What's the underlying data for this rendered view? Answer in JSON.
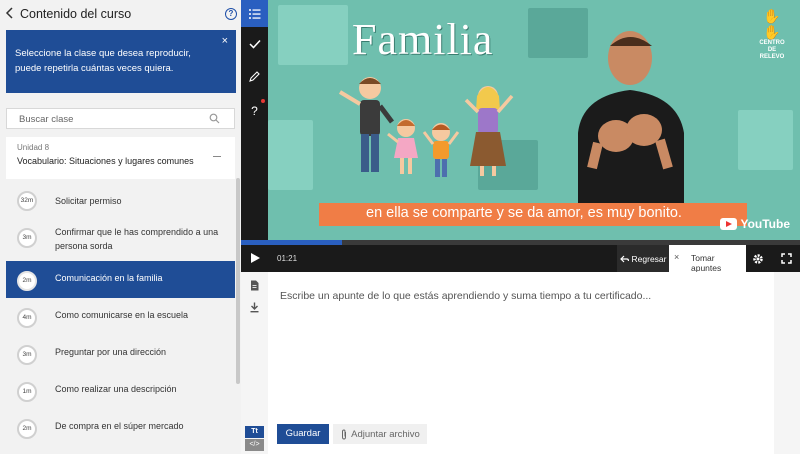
{
  "sidebar": {
    "back_icon": "chevron-left-icon",
    "title": "Contenido del curso",
    "help_icon": "question-circle-icon",
    "help_glyph": "?",
    "notice": {
      "text": "Seleccione la clase que desea reproducir, puede repetirla cuántas veces quiera.",
      "close_glyph": "×"
    },
    "search": {
      "placeholder": "Buscar clase"
    },
    "unit": {
      "label": "Unidad 8",
      "name": "Vocabulario: Situaciones y lugares comunes"
    },
    "lessons": [
      {
        "duration": "32m",
        "title": "Solicitar permiso",
        "active": false
      },
      {
        "duration": "3m",
        "title": "Confirmar que le has comprendido a una persona sorda",
        "active": false
      },
      {
        "duration": "2m",
        "title": "Comunicación en la familia",
        "active": true
      },
      {
        "duration": "4m",
        "title": "Como comunicarse en la escuela",
        "active": false
      },
      {
        "duration": "3m",
        "title": "Preguntar por una dirección",
        "active": false
      },
      {
        "duration": "1m",
        "title": "Como realizar una descripción",
        "active": false
      },
      {
        "duration": "2m",
        "title": "De compra en el súper mercado",
        "active": false
      }
    ]
  },
  "rail": {
    "items": [
      "list-icon",
      "check-icon",
      "pencil-icon",
      "question-icon"
    ],
    "question_glyph": "?"
  },
  "video": {
    "title": "Familia",
    "logo_text": "CENTRO DE RELEVO",
    "subtitle": "en ella se comparte y se da amor, es muy bonito.",
    "youtube_label": "YouTube",
    "progress": 0.18
  },
  "controls": {
    "time": "01:21",
    "back_label": "Regresar",
    "notes_tab_label": "Tomar apuntes",
    "notes_tab_close": "×"
  },
  "notes": {
    "placeholder": "Escribe un apunte de lo que estás aprendiendo y suma tiempo a tu certificado...",
    "format_text_label": "Tt",
    "format_code_label": "</>",
    "save_label": "Guardar",
    "attach_label": "Adjuntar archivo"
  },
  "colors": {
    "primary": "#1f4d96",
    "accent": "#2a5fc0",
    "video_bg": "#6fbfae",
    "subtitle_bg": "#f07d46"
  }
}
